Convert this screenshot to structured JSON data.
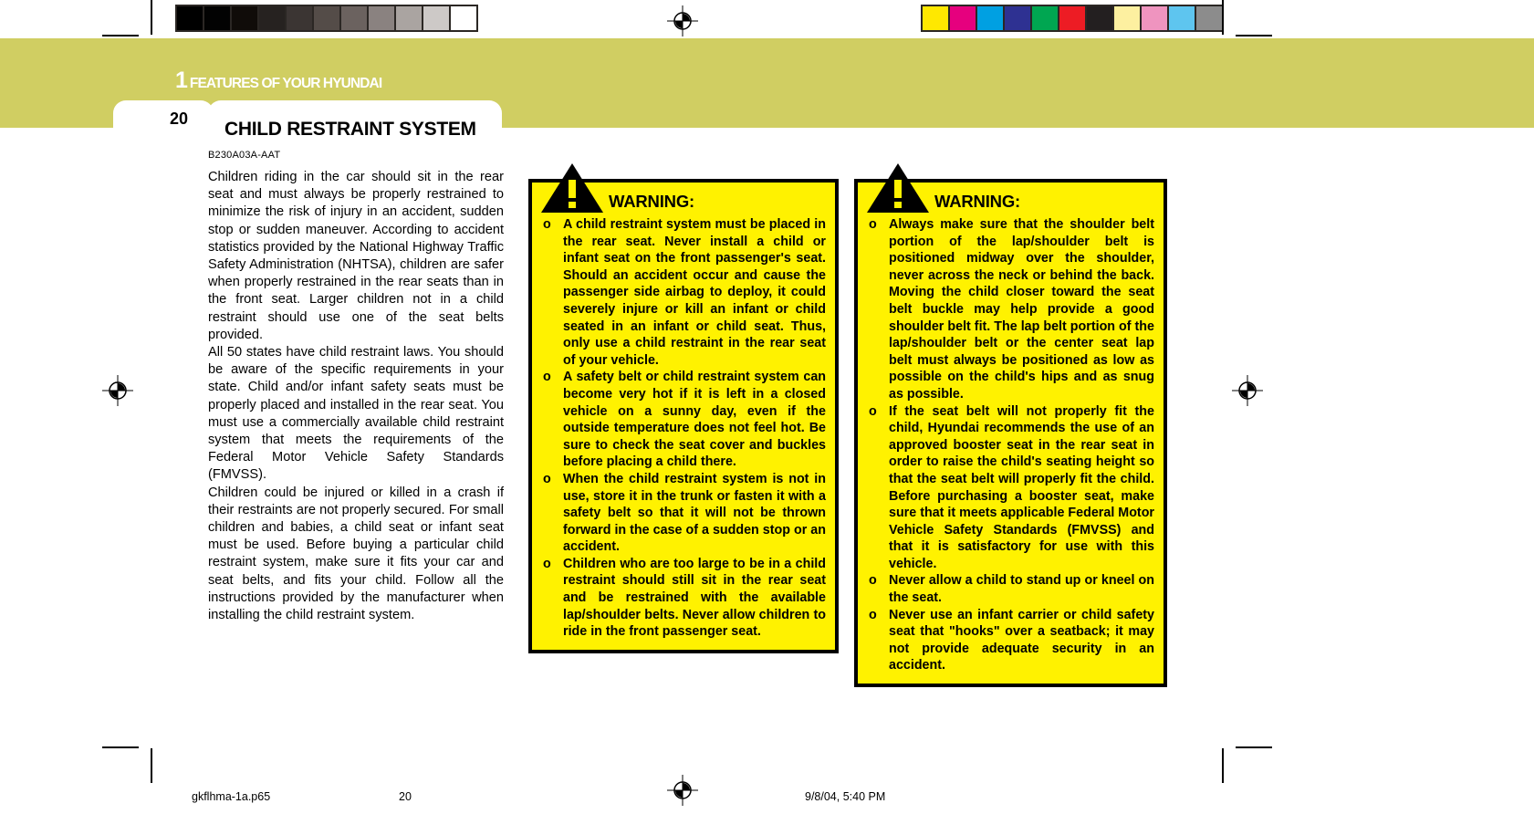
{
  "header": {
    "chapter_number": "1",
    "chapter_title": "FEATURES OF YOUR HYUNDAI",
    "page_number": "20",
    "section_title": "CHILD RESTRAINT SYSTEM",
    "band_color": "#d0ce62"
  },
  "body": {
    "part_code": "B230A03A-AAT",
    "paragraphs": [
      "Children riding in the car should sit in the rear seat and must always be properly restrained to minimize the risk of injury in an accident, sudden stop or sudden maneuver. According to accident statistics provided by the National Highway Traffic Safety Administration (NHTSA), children are safer when properly restrained in the rear seats than in the front seat. Larger children not in a child restraint should use one of the seat belts provided.",
      "All 50 states have child restraint laws. You should be aware of the specific requirements in your state. Child and/or infant safety seats must be properly placed and installed in the rear seat. You must use a commercially available child restraint system that meets the requirements of the Federal Motor Vehicle Safety Standards (FMVSS).",
      "Children could be injured or killed in a crash if their restraints are not properly secured. For small children and babies, a child seat or infant seat must be used. Before buying a particular child restraint system, make sure it fits your car and seat belts, and fits your child. Follow all the instructions provided by the manufacturer when installing the child restraint system."
    ]
  },
  "warnings": [
    {
      "label": "WARNING:",
      "bullet_marker": "o",
      "background_color": "#fff200",
      "items": [
        "A child restraint system must be placed in the rear seat. Never install a child or infant seat on the front passenger's seat. Should an accident occur and cause the passenger side airbag to deploy, it could severely injure or kill an infant or child seated in an infant or child seat. Thus, only use a child restraint in the rear seat of your vehicle.",
        "A safety belt or child restraint system can become very hot if it is left in a closed vehicle on a sunny day, even if the outside temperature does not feel hot. Be sure to check the seat cover and buckles before placing a child there.",
        "When the child restraint system is not in use, store it in the trunk or fasten it with a safety belt so that it will not be thrown forward in the case of a sudden stop or an accident.",
        "Children who are too large to be in a child restraint should still sit in the rear seat and be restrained with the available lap/shoulder belts. Never allow children to ride in the front passenger seat."
      ]
    },
    {
      "label": "WARNING:",
      "bullet_marker": "o",
      "background_color": "#fff200",
      "items": [
        "Always make sure that the shoulder belt portion of the lap/shoulder belt is positioned midway over the shoulder, never across the neck or behind the back. Moving the child closer toward the seat belt buckle may help provide a good shoulder belt fit. The lap belt portion of the lap/shoulder belt or the center seat lap belt must always be positioned as low as possible on the child's hips and as snug as possible.",
        "If the seat belt will not properly fit the child, Hyundai recommends the use of an approved booster seat in the rear seat in order to raise the child's seating height so that the seat belt will properly fit the child. Before purchasing a booster seat, make sure that it meets applicable Federal Motor Vehicle Safety Standards (FMVSS) and that it is satisfactory for use with this vehicle.",
        "Never allow a child to stand up or kneel on the seat.",
        "Never use an infant carrier or child safety seat that \"hooks\" over a seatback; it may not provide adequate security in an accident."
      ]
    }
  ],
  "color_bars": {
    "grayscale": [
      "#000000",
      "#020202",
      "#100c09",
      "#262220",
      "#3b3533",
      "#544c48",
      "#6b625f",
      "#8a8280",
      "#aaa4a1",
      "#cdc9c7",
      "#ffffff"
    ],
    "cmyk": [
      "#ffe800",
      "#e6007e",
      "#00a0e2",
      "#2e3192",
      "#00a651",
      "#ed1c24",
      "#231f20",
      "#fdf0a0",
      "#ef94bf",
      "#5ec5ef",
      "#8c8c8c"
    ]
  },
  "footer": {
    "filename": "gkflhma-1a.p65",
    "page": "20",
    "timestamp": "9/8/04, 5:40 PM"
  }
}
